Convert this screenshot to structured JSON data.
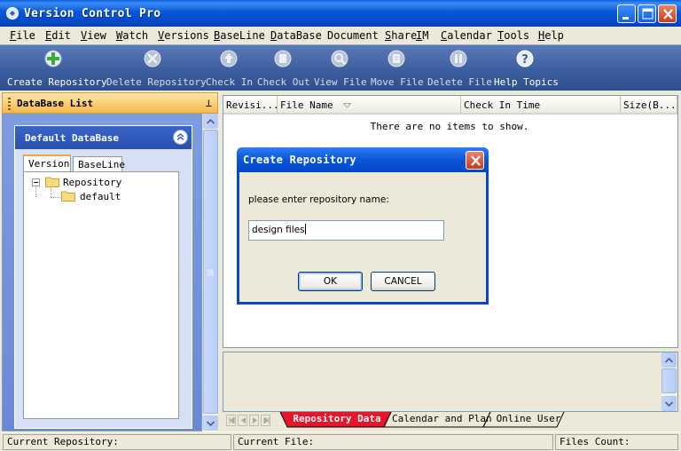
{
  "window": {
    "title": "Version Control Pro"
  },
  "menu": [
    "File",
    "Edit",
    "View",
    "Watch",
    "Versions",
    "BaseLine",
    "DataBase",
    "Document Share",
    "IM",
    "Calendar",
    "Tools",
    "Help"
  ],
  "menu_underline": [
    "F",
    "E",
    "V",
    "W",
    "V",
    "B",
    "D",
    "S",
    "I",
    "C",
    "T",
    "H"
  ],
  "toolbar": {
    "create_repository": "Create Repository",
    "delete_repository": "Delete Repository",
    "check_in": "Check In",
    "check_out": "Check Out",
    "view_file": "View File",
    "move_file": "Move File",
    "delete_file": "Delete File",
    "help_topics": "Help Topics"
  },
  "left_panel": {
    "header": "DataBase List",
    "pin": "⊥",
    "group_title": "Default DataBase",
    "tabs": [
      "Version",
      "BaseLine"
    ],
    "tree": {
      "root": "Repository",
      "child": "default"
    }
  },
  "list": {
    "columns": [
      "Revisi...",
      "File Name",
      "Check In Time",
      "Size(B..."
    ],
    "empty_message": "There are no items to show."
  },
  "sheet_tabs": [
    "Repository Data",
    "Calendar and Plan",
    "Online User"
  ],
  "status": {
    "current_repository": "Current Repository:",
    "current_file": "Current File:",
    "files_count": "Files Count:"
  },
  "dialog": {
    "title": "Create Repository",
    "prompt": "please enter repository name:",
    "input_value": "design files",
    "ok": "OK",
    "cancel": "CANCEL"
  },
  "colors": {
    "titlebar": "#0856d8",
    "toolbar": "#3b5c9c",
    "panel_header": "#f6b84c",
    "active_sheet_tab": "#e8142a"
  }
}
